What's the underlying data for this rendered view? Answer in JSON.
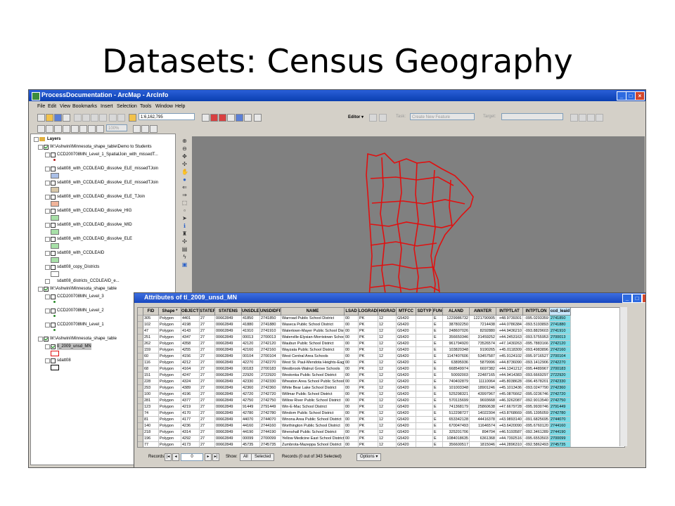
{
  "slide": {
    "title": "Datasets: Census Geography"
  },
  "window": {
    "title": "ProcessDocumentation - ArcMap - ArcInfo",
    "colors": {
      "titlebar": "#1848c0",
      "boundary": "#e01010",
      "map_bg": "#808080",
      "highlight": "#7fdde8"
    }
  },
  "menu": [
    "File",
    "Edit",
    "View",
    "Bookmarks",
    "Insert",
    "Selection",
    "Tools",
    "Window",
    "Help"
  ],
  "toolbar": {
    "scale": "1:6,162,795",
    "editor_label": "Editor ▾",
    "task_label": "Task:",
    "task_value": "Create New Feature",
    "target_label": "Target:",
    "zoom_percent": "100%"
  },
  "toc": {
    "root": "Layers",
    "items": [
      {
        "text": "W:\\Ashwini\\Minnesota_shape_table\\Demo to Students",
        "level": 1,
        "type": "group"
      },
      {
        "text": "CCD200708MN_Level_1_SpatialJoin_with_missedT...",
        "level": 2,
        "type": "layer",
        "sym": "dot-red"
      },
      {
        "text": "sdatt08_with_CCDLEAID_dissolve_ELE_missedTJoin",
        "level": 2,
        "type": "layer",
        "sym": "box-blue"
      },
      {
        "text": "sdatt08_with_CCDLEAID_dissolve_ELE_missedTJoin",
        "level": 2,
        "type": "layer",
        "sym": "box-tan"
      },
      {
        "text": "sdatt08_with_CCDLEAID_dissolve_ELE_TJoin",
        "level": 2,
        "type": "layer",
        "sym": "box-peach"
      },
      {
        "text": "sdatt08_with_CCDLEAID_dissolve_HIG",
        "level": 2,
        "type": "layer",
        "sym": "box-green"
      },
      {
        "text": "sdatt08_with_CCDLEAID_dissolve_MID",
        "level": 2,
        "type": "layer",
        "sym": "box-green"
      },
      {
        "text": "sdatt08_with_CCDLEAID_dissolve_ELE",
        "level": 2,
        "type": "layer",
        "sym": "box-green"
      },
      {
        "text": "sdatt08_with_CCDLEAID",
        "level": 2,
        "type": "layer",
        "sym": "box-green"
      },
      {
        "text": "sdatt08_copy_Districts",
        "level": 2,
        "type": "layer",
        "sym": "box-white"
      },
      {
        "text": "sdatt08_districts_CCDLEAID_e...",
        "level": 2,
        "type": "table",
        "sym": "none"
      },
      {
        "text": "W:\\Ashwini\\Minnesota_shape_table",
        "level": 1,
        "type": "group"
      },
      {
        "text": "CCD200708MN_Level_3",
        "level": 2,
        "type": "layer",
        "sym": "dot-green"
      },
      {
        "text": "CCD200708MN_Level_2",
        "level": 2,
        "type": "layer",
        "sym": "dot-green"
      },
      {
        "text": "CCD200708MN_Level_1",
        "level": 2,
        "type": "layer",
        "sym": "dot-green"
      },
      {
        "text": "W:\\Ashwini\\Minnesota_shape_table",
        "level": 1,
        "type": "group"
      },
      {
        "text": "tl_2009_unsd_MN",
        "level": 2,
        "type": "layer-checked",
        "sym": "box-red"
      },
      {
        "text": "sdatt08",
        "level": 2,
        "type": "layer",
        "sym": "box-black"
      }
    ]
  },
  "attributes": {
    "title": "Attributes of tl_2009_unsd_MN",
    "columns": [
      "FID",
      "Shape *",
      "OBJECTID",
      "STATEFP",
      "STATENS",
      "UNSDLEA",
      "UNSDIDFP",
      "NAME",
      "LSAD",
      "LOGRADE",
      "HIGRAD",
      "MTFCC",
      "SDTYP",
      "FUNC",
      "ALAND",
      "AWATER",
      "INTPTLAT",
      "INTPTLON",
      "ccd_leaid"
    ],
    "rows": [
      [
        "305",
        "Polygon",
        "4401",
        "27",
        "00662849",
        "41850",
        "2741850",
        "Warroad Public School District",
        "00",
        "PK",
        "12",
        "G5420",
        "",
        "E",
        "1229986732",
        "1221790905",
        "+48.9739301",
        "-095.0293359",
        "2741850"
      ],
      [
        "102",
        "Polygon",
        "4198",
        "27",
        "00662849",
        "41880",
        "2741880",
        "Waseca Public School District",
        "00",
        "PK",
        "12",
        "G5420",
        "",
        "E",
        "387802250",
        "7214438",
        "+44.0786384",
        "-093.5193893",
        "2741880"
      ],
      [
        "47",
        "Polygon",
        "4143",
        "27",
        "00662849",
        "41910",
        "2741910",
        "Watertown-Mayer Public School District",
        "00",
        "PK",
        "12",
        "G5420",
        "",
        "E",
        "248607026",
        "8292880",
        "+44.9436210",
        "-093.8829603",
        "2741910"
      ],
      [
        "251",
        "Polygon",
        "4347",
        "27",
        "00662849",
        "00013",
        "2700013",
        "Waterville-Elysian-Morristown School Dis",
        "00",
        "PK",
        "12",
        "G5420",
        "",
        "E",
        "356650346",
        "31459252",
        "+44.2453163",
        "-093.5755953",
        "2700013"
      ],
      [
        "262",
        "Polygon",
        "4358",
        "27",
        "00662849",
        "42120",
        "2742120",
        "Waubun Public School District",
        "00",
        "PK",
        "12",
        "G5420",
        "",
        "E",
        "961794920",
        "73526574",
        "+47.1430263",
        "-095.7883166",
        "2742120"
      ],
      [
        "159",
        "Polygon",
        "4255",
        "27",
        "00662849",
        "42160",
        "2742160",
        "Wayzata Public School District",
        "00",
        "PK",
        "12",
        "G5420",
        "",
        "E",
        "103820348",
        "9190265",
        "+45.0118309",
        "-093.4983896",
        "2742160"
      ],
      [
        "60",
        "Polygon",
        "4156",
        "27",
        "00662849",
        "00104",
        "2700104",
        "West Central Area Schools",
        "00",
        "PK",
        "12",
        "G5420",
        "",
        "E",
        "1147407606",
        "53457587",
        "+45.9124102",
        "-095.9716527",
        "2700104"
      ],
      [
        "116",
        "Polygon",
        "4212",
        "27",
        "00662849",
        "42270",
        "2742270",
        "West St. Paul-Mendota Heights-Eagan Sc",
        "00",
        "PK",
        "12",
        "G5420",
        "",
        "E",
        "63895936",
        "5879996",
        "+44.8736090",
        "-093.1412906",
        "2742270"
      ],
      [
        "68",
        "Polygon",
        "4164",
        "27",
        "00662849",
        "00183",
        "2700183",
        "Westbrook-Walnut Grove Schools",
        "00",
        "PK",
        "12",
        "G5420",
        "",
        "E",
        "668549974",
        "6697382",
        "+44.1341212",
        "-095.4489967",
        "2700183"
      ],
      [
        "151",
        "Polygon",
        "4247",
        "27",
        "00662849",
        "22920",
        "2722920",
        "Westonka Public School District",
        "00",
        "PK",
        "12",
        "G5420",
        "",
        "E",
        "50092003",
        "22487165",
        "+44.9414383",
        "-093.6669297",
        "2722920"
      ],
      [
        "228",
        "Polygon",
        "4324",
        "27",
        "00662849",
        "42330",
        "2742330",
        "Wheaton Area School Public School Distr",
        "00",
        "PK",
        "12",
        "G5420",
        "",
        "E",
        "740402879",
        "11110064",
        "+45.8038628",
        "-096.4578201",
        "2742330"
      ],
      [
        "293",
        "Polygon",
        "4389",
        "27",
        "00662849",
        "42360",
        "2742360",
        "White Bear Lake School District",
        "00",
        "PK",
        "12",
        "G5420",
        "",
        "E",
        "101003348",
        "18901246",
        "+45.1013436",
        "-093.0247790",
        "2742360"
      ],
      [
        "100",
        "Polygon",
        "4196",
        "27",
        "00662849",
        "42720",
        "2742720",
        "Willmar Public School District",
        "00",
        "PK",
        "12",
        "G5420",
        "",
        "E",
        "525298321",
        "43997967",
        "+45.0876662",
        "-095.0236746",
        "2742720"
      ],
      [
        "281",
        "Polygon",
        "4377",
        "27",
        "00662849",
        "42750",
        "2742750",
        "Willow River Public School District",
        "00",
        "PK",
        "12",
        "G5420",
        "",
        "E",
        "570115699",
        "9693668",
        "+46.3262087",
        "-092.9013540",
        "2742750"
      ],
      [
        "123",
        "Polygon",
        "4219",
        "27",
        "00662849",
        "91449",
        "2791449",
        "Win-E-Mac School District",
        "00",
        "PK",
        "12",
        "G5420",
        "",
        "E",
        "741368179",
        "25860638",
        "+47.6679728",
        "-095.9930746",
        "2791449"
      ],
      [
        "74",
        "Polygon",
        "4170",
        "27",
        "00662849",
        "42780",
        "2742780",
        "Windom Public School District",
        "00",
        "PK",
        "12",
        "G5420",
        "",
        "E",
        "512298727",
        "14022304",
        "+43.8768669",
        "-095.1395059",
        "2742780"
      ],
      [
        "81",
        "Polygon",
        "4177",
        "27",
        "00662849",
        "44070",
        "2744070",
        "Winona Area Public School District",
        "00",
        "PK",
        "12",
        "G5420",
        "",
        "E",
        "653342128",
        "44416378",
        "+43.9893140",
        "-091.6825695",
        "2744070"
      ],
      [
        "140",
        "Polygon",
        "4236",
        "27",
        "00662849",
        "44160",
        "2744160",
        "Worthington Public School District",
        "00",
        "PK",
        "12",
        "G5420",
        "",
        "E",
        "670047493",
        "11646574",
        "+43.6420090",
        "-095.6760120",
        "2744160"
      ],
      [
        "218",
        "Polygon",
        "4314",
        "27",
        "00662849",
        "44190",
        "2744190",
        "Wrenshall Public School District",
        "00",
        "PK",
        "12",
        "G5420",
        "",
        "E",
        "325201706",
        "894704",
        "+46.5193587",
        "-092.3461289",
        "2744190"
      ],
      [
        "196",
        "Polygon",
        "4292",
        "27",
        "00662849",
        "00099",
        "2700099",
        "Yellow Medicine East School District",
        "00",
        "PK",
        "12",
        "G5420",
        "",
        "E",
        "1084018635",
        "6361368",
        "+44.7392516",
        "-095.6553503",
        "2700099"
      ],
      [
        "77",
        "Polygon",
        "4173",
        "27",
        "00662849",
        "45735",
        "2745735",
        "Zumbrota-Mazeppa School District",
        "00",
        "PK",
        "12",
        "G5420",
        "",
        "E",
        "356600517",
        "1815046",
        "+44.2896310",
        "-092.5862493",
        "2745735"
      ]
    ],
    "status": {
      "records_label": "Records:",
      "record_value": "0",
      "show_label": "Show:",
      "all_label": "All",
      "selected_label": "Selected",
      "records_info": "Records (0 out of 343 Selected)",
      "options_label": "Options ▾"
    }
  }
}
